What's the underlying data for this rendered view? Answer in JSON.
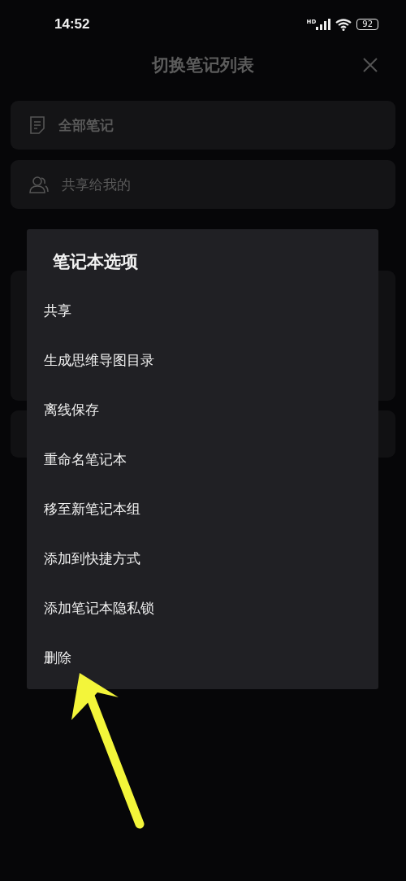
{
  "status_bar": {
    "time": "14:52",
    "network": "HD",
    "battery": "92"
  },
  "header": {
    "title": "切换笔记列表"
  },
  "lists": [
    {
      "kind": "notes",
      "label": "全部笔记"
    },
    {
      "kind": "shared",
      "label": "共享给我的"
    }
  ],
  "dialog": {
    "title": "笔记本选项",
    "items": [
      "共享",
      "生成思维导图目录",
      "离线保存",
      "重命名笔记本",
      "移至新笔记本组",
      "添加到快捷方式",
      "添加笔记本隐私锁",
      "删除"
    ]
  }
}
